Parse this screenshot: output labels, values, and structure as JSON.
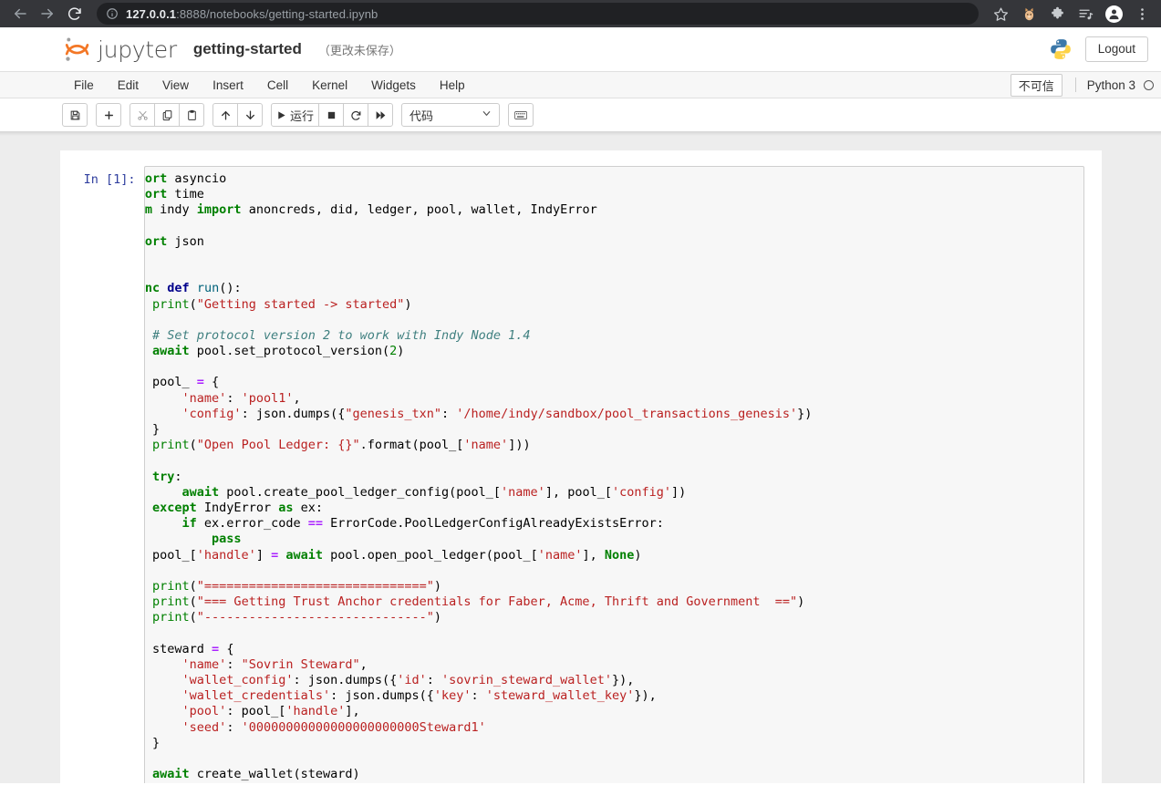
{
  "browser": {
    "back_icon": "back-arrow-icon",
    "forward_icon": "forward-arrow-icon",
    "reload_icon": "reload-icon",
    "site_info_icon": "info-circle-icon",
    "url_host": "127.0.0.1",
    "url_rest": ":8888/notebooks/getting-started.ipynb",
    "bookmark_icon": "star-icon",
    "extension_icons": [
      "cat-extension-icon",
      "puzzle-extension-icon",
      "reading-list-icon"
    ],
    "profile_icon": "profile-avatar-icon",
    "menu_icon": "three-dot-menu-icon"
  },
  "header": {
    "logo_icon": "jupyter-logo-icon",
    "brand": "jupyter",
    "notebook_name": "getting-started",
    "save_status": "（更改未保存）",
    "python_logo_icon": "python-logo-icon",
    "logout_label": "Logout"
  },
  "menubar": {
    "items": [
      {
        "label": "File"
      },
      {
        "label": "Edit"
      },
      {
        "label": "View"
      },
      {
        "label": "Insert"
      },
      {
        "label": "Cell"
      },
      {
        "label": "Kernel"
      },
      {
        "label": "Widgets"
      },
      {
        "label": "Help"
      }
    ],
    "trust_badge": "不可信",
    "kernel_name": "Python 3",
    "kernel_status_icon": "kernel-idle-circle-icon"
  },
  "toolbar": {
    "buttons": [
      {
        "name": "save-button",
        "icon": "floppy-disk-icon",
        "label": ""
      },
      {
        "name": "insert-cell-below-button",
        "icon": "plus-icon",
        "label": ""
      },
      {
        "name": "cut-cell-button",
        "icon": "scissors-icon",
        "label": ""
      },
      {
        "name": "copy-cell-button",
        "icon": "copy-icon",
        "label": ""
      },
      {
        "name": "paste-cell-button",
        "icon": "paste-icon",
        "label": ""
      },
      {
        "name": "move-cell-up-button",
        "icon": "arrow-up-icon",
        "label": ""
      },
      {
        "name": "move-cell-down-button",
        "icon": "arrow-down-icon",
        "label": ""
      },
      {
        "name": "run-cell-button",
        "icon": "play-icon",
        "label": "运行"
      },
      {
        "name": "interrupt-kernel-button",
        "icon": "stop-square-icon",
        "label": ""
      },
      {
        "name": "restart-kernel-button",
        "icon": "restart-circle-icon",
        "label": ""
      },
      {
        "name": "restart-and-run-all-button",
        "icon": "fast-forward-icon",
        "label": ""
      },
      {
        "name": "command-palette-button",
        "icon": "keyboard-icon",
        "label": ""
      }
    ],
    "run_label": "运行",
    "cell_type_value": "代码",
    "cell_type_caret_icon": "chevron-down-icon",
    "keyboard_icon": "keyboard-icon"
  },
  "notebook": {
    "input_prompt": "In [1]:",
    "code_lines": [
      "import asyncio",
      "import time",
      "from indy import anoncreds, did, ledger, pool, wallet, IndyError",
      "",
      "import json",
      "",
      "",
      "async def run():",
      "    print(\"Getting started -> started\")",
      "",
      "    # Set protocol version 2 to work with Indy Node 1.4",
      "    await pool.set_protocol_version(2)",
      "",
      "    pool_ = {",
      "        'name': 'pool1',",
      "        'config': json.dumps({\"genesis_txn\": '/home/indy/sandbox/pool_transactions_genesis'})",
      "    }",
      "    print(\"Open Pool Ledger: {}\".format(pool_['name']))",
      "",
      "    try:",
      "        await pool.create_pool_ledger_config(pool_['name'], pool_['config'])",
      "    except IndyError as ex:",
      "        if ex.error_code == ErrorCode.PoolLedgerConfigAlreadyExistsError:",
      "            pass",
      "    pool_['handle'] = await pool.open_pool_ledger(pool_['name'], None)",
      "",
      "    print(\"==============================\")",
      "    print(\"=== Getting Trust Anchor credentials for Faber, Acme, Thrift and Government  ==\")",
      "    print(\"------------------------------\")",
      "",
      "    steward = {",
      "        'name': \"Sovrin Steward\",",
      "        'wallet_config': json.dumps({'id': 'sovrin_steward_wallet'}),",
      "        'wallet_credentials': json.dumps({'key': 'steward_wallet_key'}),",
      "        'pool': pool_['handle'],",
      "        'seed': '00000000000000000000000Steward1'",
      "    }",
      "",
      "    await create_wallet(steward)"
    ]
  },
  "colors": {
    "chrome_bar": "#35363a",
    "omnibox": "#202124",
    "accent_orange": "#f37726",
    "cell_background": "#f7f7f7",
    "prompt_blue": "#303F9F",
    "string_red": "#BA2121",
    "keyword_green": "#008000",
    "comment_teal": "#408080",
    "operator_purple": "#AA22FF"
  }
}
